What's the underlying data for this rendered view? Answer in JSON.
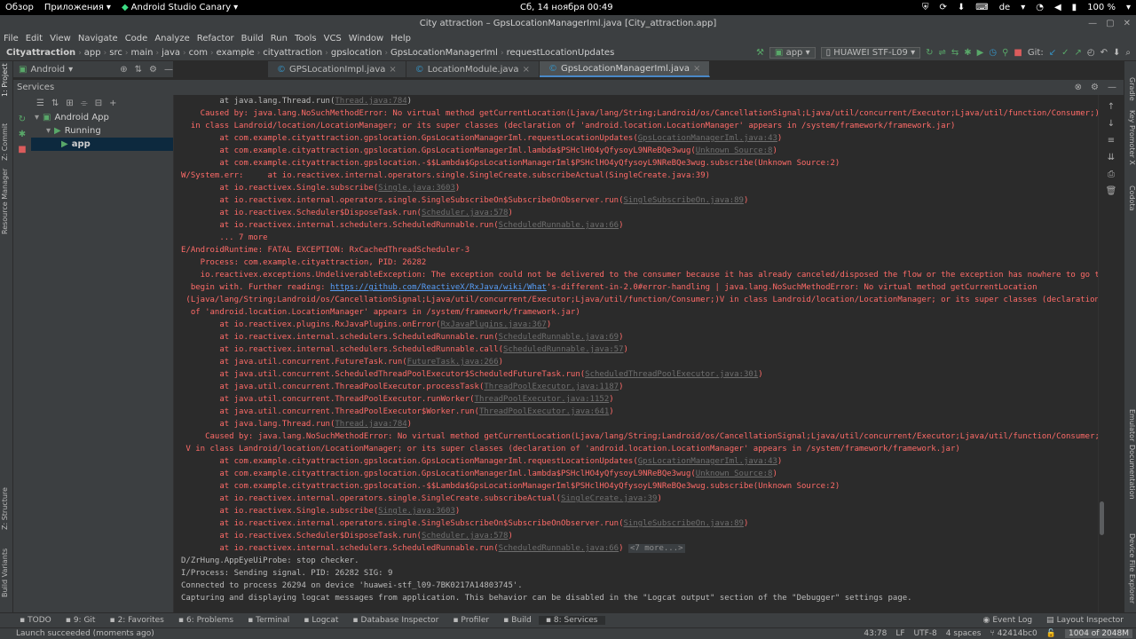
{
  "gnome_bar": {
    "overview": "Обзор",
    "apps": "Приложения",
    "app_name": "Android Studio Canary",
    "clock": "Сб, 14 ноября  00:49",
    "lang": "de",
    "battery": "100 %"
  },
  "window": {
    "title": "City attraction – GpsLocationManagerIml.java [City_attraction.app]"
  },
  "menu": [
    "File",
    "Edit",
    "View",
    "Navigate",
    "Code",
    "Analyze",
    "Refactor",
    "Build",
    "Run",
    "Tools",
    "VCS",
    "Window",
    "Help"
  ],
  "breadcrumbs": [
    "Cityattraction",
    "app",
    "src",
    "main",
    "java",
    "com",
    "example",
    "cityattraction",
    "gpslocation",
    "GpsLocationManagerIml",
    "requestLocationUpdates"
  ],
  "toolbar": {
    "run_config": "app",
    "device": "HUAWEI STF-L09",
    "git_label": "Git:"
  },
  "project_view": {
    "mode": "Android"
  },
  "editor_tabs": [
    {
      "label": "GPSLocationImpl.java",
      "active": false
    },
    {
      "label": "LocationModule.java",
      "active": false
    },
    {
      "label": "GpsLocationManagerIml.java",
      "active": true
    }
  ],
  "services": {
    "title": "Services",
    "tree": [
      {
        "label": "Android App",
        "level": 0
      },
      {
        "label": "Running",
        "level": 1
      },
      {
        "label": "app",
        "level": 2
      }
    ]
  },
  "left_strip": [
    "1: Project",
    "Z: Commit",
    "Resource Manager",
    "Z: Structure",
    "Build Variants",
    "2: Favorites"
  ],
  "right_strip": [
    "Gradle",
    "Key Promoter X",
    "Codota",
    "Emulator",
    "Documentation",
    "Device File Explorer"
  ],
  "console_lines": [
    {
      "type": "n",
      "parts": [
        {
          "t": "        at java.lang.Thread.run("
        },
        {
          "t": "Thread.java:784",
          "c": "lnk"
        },
        {
          "t": ")"
        }
      ]
    },
    {
      "type": "e",
      "parts": [
        {
          "t": "    Caused by: java.lang.NoSuchMethodError: No virtual method getCurrentLocation(Ljava/lang/String;Landroid/os/CancellationSignal;Ljava/util/concurrent/Executor;Ljava/util/function/Consumer;)V"
        }
      ]
    },
    {
      "type": "e",
      "parts": [
        {
          "t": "  in class Landroid/location/LocationManager; or its super classes (declaration of 'android.location.LocationManager' appears in /system/framework/framework.jar)"
        }
      ]
    },
    {
      "type": "e",
      "parts": [
        {
          "t": "        at com.example.cityattraction.gpslocation.GpsLocationManagerIml.requestLocationUpdates("
        },
        {
          "t": "GpsLocationManagerIml.java:43",
          "c": "lnk"
        },
        {
          "t": ")"
        }
      ]
    },
    {
      "type": "e",
      "parts": [
        {
          "t": "        at com.example.cityattraction.gpslocation.GpsLocationManagerIml.lambda$PSHclHO4yQfysoyL9NReBQe3wug("
        },
        {
          "t": "Unknown Source:8",
          "c": "lnk"
        },
        {
          "t": ")"
        }
      ]
    },
    {
      "type": "e",
      "parts": [
        {
          "t": "        at com.example.cityattraction.gpslocation.-$$Lambda$GpsLocationManagerIml$PSHclHO4yQfysoyL9NReBQe3wug.subscribe(Unknown Source:2)"
        }
      ]
    },
    {
      "type": "e",
      "parts": [
        {
          "t": "W/System.err:     at io.reactivex.internal.operators.single.SingleCreate.subscribeActual(SingleCreate.java:39)"
        }
      ]
    },
    {
      "type": "e",
      "parts": [
        {
          "t": "        at io.reactivex.Single.subscribe("
        },
        {
          "t": "Single.java:3603",
          "c": "lnk"
        },
        {
          "t": ")"
        }
      ]
    },
    {
      "type": "e",
      "parts": [
        {
          "t": "        at io.reactivex.internal.operators.single.SingleSubscribeOn$SubscribeOnObserver.run("
        },
        {
          "t": "SingleSubscribeOn.java:89",
          "c": "lnk"
        },
        {
          "t": ")"
        }
      ]
    },
    {
      "type": "e",
      "parts": [
        {
          "t": "        at io.reactivex.Scheduler$DisposeTask.run("
        },
        {
          "t": "Scheduler.java:578",
          "c": "lnk"
        },
        {
          "t": ")"
        }
      ]
    },
    {
      "type": "e",
      "parts": [
        {
          "t": "        at io.reactivex.internal.schedulers.ScheduledRunnable.run("
        },
        {
          "t": "ScheduledRunnable.java:66",
          "c": "lnk"
        },
        {
          "t": ")"
        }
      ]
    },
    {
      "type": "e",
      "parts": [
        {
          "t": "        ... 7 more"
        }
      ]
    },
    {
      "type": "e",
      "parts": [
        {
          "t": "E/AndroidRuntime: FATAL EXCEPTION: RxCachedThreadScheduler-3"
        }
      ]
    },
    {
      "type": "e",
      "parts": [
        {
          "t": "    Process: com.example.cityattraction, PID: 26282"
        }
      ]
    },
    {
      "type": "e",
      "parts": [
        {
          "t": "    io.reactivex.exceptions.UndeliverableException: The exception could not be delivered to the consumer because it has already canceled/disposed the flow or the exception has nowhere to go to"
        }
      ]
    },
    {
      "type": "e",
      "parts": [
        {
          "t": "  begin with. Further reading: "
        },
        {
          "t": "https://github.com/ReactiveX/RxJava/wiki/What",
          "c": "url"
        },
        {
          "t": "'s-different-in-2.0#error-handling | java.lang.NoSuchMethodError: No virtual method getCurrentLocation"
        }
      ]
    },
    {
      "type": "e",
      "parts": [
        {
          "t": " (Ljava/lang/String;Landroid/os/CancellationSignal;Ljava/util/concurrent/Executor;Ljava/util/function/Consumer;)V in class Landroid/location/LocationManager; or its super classes (declaration"
        }
      ]
    },
    {
      "type": "e",
      "parts": [
        {
          "t": "  of 'android.location.LocationManager' appears in /system/framework/framework.jar)"
        }
      ]
    },
    {
      "type": "e",
      "parts": [
        {
          "t": "        at io.reactivex.plugins.RxJavaPlugins.onError("
        },
        {
          "t": "RxJavaPlugins.java:367",
          "c": "lnk"
        },
        {
          "t": ")"
        }
      ]
    },
    {
      "type": "e",
      "parts": [
        {
          "t": "        at io.reactivex.internal.schedulers.ScheduledRunnable.run("
        },
        {
          "t": "ScheduledRunnable.java:69",
          "c": "lnk"
        },
        {
          "t": ")"
        }
      ]
    },
    {
      "type": "e",
      "parts": [
        {
          "t": "        at io.reactivex.internal.schedulers.ScheduledRunnable.call("
        },
        {
          "t": "ScheduledRunnable.java:57",
          "c": "lnk"
        },
        {
          "t": ")"
        }
      ]
    },
    {
      "type": "e",
      "parts": [
        {
          "t": "        at java.util.concurrent.FutureTask.run("
        },
        {
          "t": "FutureTask.java:266",
          "c": "lnk"
        },
        {
          "t": ")"
        }
      ]
    },
    {
      "type": "e",
      "parts": [
        {
          "t": "        at java.util.concurrent.ScheduledThreadPoolExecutor$ScheduledFutureTask.run("
        },
        {
          "t": "ScheduledThreadPoolExecutor.java:301",
          "c": "lnk"
        },
        {
          "t": ")"
        }
      ]
    },
    {
      "type": "e",
      "parts": [
        {
          "t": "        at java.util.concurrent.ThreadPoolExecutor.processTask("
        },
        {
          "t": "ThreadPoolExecutor.java:1187",
          "c": "lnk"
        },
        {
          "t": ")"
        }
      ]
    },
    {
      "type": "e",
      "parts": [
        {
          "t": "        at java.util.concurrent.ThreadPoolExecutor.runWorker("
        },
        {
          "t": "ThreadPoolExecutor.java:1152",
          "c": "lnk"
        },
        {
          "t": ")"
        }
      ]
    },
    {
      "type": "e",
      "parts": [
        {
          "t": "        at java.util.concurrent.ThreadPoolExecutor$Worker.run("
        },
        {
          "t": "ThreadPoolExecutor.java:641",
          "c": "lnk"
        },
        {
          "t": ")"
        }
      ]
    },
    {
      "type": "e",
      "parts": [
        {
          "t": "        at java.lang.Thread.run("
        },
        {
          "t": "Thread.java:784",
          "c": "lnk"
        },
        {
          "t": ")"
        }
      ]
    },
    {
      "type": "e",
      "parts": [
        {
          "t": "     Caused by: java.lang.NoSuchMethodError: No virtual method getCurrentLocation(Ljava/lang/String;Landroid/os/CancellationSignal;Ljava/util/concurrent/Executor;Ljava/util/function/Consumer;)"
        }
      ]
    },
    {
      "type": "e",
      "parts": [
        {
          "t": " V in class Landroid/location/LocationManager; or its super classes (declaration of 'android.location.LocationManager' appears in /system/framework/framework.jar)"
        }
      ]
    },
    {
      "type": "e",
      "parts": [
        {
          "t": "        at com.example.cityattraction.gpslocation.GpsLocationManagerIml.requestLocationUpdates("
        },
        {
          "t": "GpsLocationManagerIml.java:43",
          "c": "lnk"
        },
        {
          "t": ")"
        }
      ]
    },
    {
      "type": "e",
      "parts": [
        {
          "t": "        at com.example.cityattraction.gpslocation.GpsLocationManagerIml.lambda$PSHclHO4yQfysoyL9NReBQe3wug("
        },
        {
          "t": "Unknown Source:8",
          "c": "lnk"
        },
        {
          "t": ")"
        }
      ]
    },
    {
      "type": "e",
      "parts": [
        {
          "t": "        at com.example.cityattraction.gpslocation.-$$Lambda$GpsLocationManagerIml$PSHclHO4yQfysoyL9NReBQe3wug.subscribe(Unknown Source:2)"
        }
      ]
    },
    {
      "type": "e",
      "parts": [
        {
          "t": "        at io.reactivex.internal.operators.single.SingleCreate.subscribeActual("
        },
        {
          "t": "SingleCreate.java:39",
          "c": "lnk"
        },
        {
          "t": ")"
        }
      ]
    },
    {
      "type": "e",
      "parts": [
        {
          "t": "        at io.reactivex.Single.subscribe("
        },
        {
          "t": "Single.java:3603",
          "c": "lnk"
        },
        {
          "t": ")"
        }
      ]
    },
    {
      "type": "e",
      "parts": [
        {
          "t": "        at io.reactivex.internal.operators.single.SingleSubscribeOn$SubscribeOnObserver.run("
        },
        {
          "t": "SingleSubscribeOn.java:89",
          "c": "lnk"
        },
        {
          "t": ")"
        }
      ]
    },
    {
      "type": "e",
      "parts": [
        {
          "t": "        at io.reactivex.Scheduler$DisposeTask.run("
        },
        {
          "t": "Scheduler.java:578",
          "c": "lnk"
        },
        {
          "t": ")"
        }
      ]
    },
    {
      "type": "e",
      "parts": [
        {
          "t": "        at io.reactivex.internal.schedulers.ScheduledRunnable.run("
        },
        {
          "t": "ScheduledRunnable.java:66",
          "c": "lnk"
        },
        {
          "t": ") "
        },
        {
          "t": "<7 more...>",
          "c": "more"
        }
      ]
    },
    {
      "type": "n",
      "parts": [
        {
          "t": "D/ZrHung.AppEyeUiProbe: stop checker."
        }
      ]
    },
    {
      "type": "n",
      "parts": [
        {
          "t": "I/Process: Sending signal. PID: 26282 SIG: 9"
        }
      ]
    },
    {
      "type": "n",
      "parts": [
        {
          "t": "Connected to process 26294 on device 'huawei-stf_l09-7BK0217A14803745'."
        }
      ]
    },
    {
      "type": "n",
      "parts": [
        {
          "t": "Capturing and displaying logcat messages from application. This behavior can be disabled in the \"Logcat output\" section of the \"Debugger\" settings page."
        }
      ]
    }
  ],
  "bottom_tools": [
    {
      "label": "TODO",
      "active": false
    },
    {
      "label": "9: Git",
      "active": false
    },
    {
      "label": "2: Favorites",
      "active": false
    },
    {
      "label": "6: Problems",
      "active": false
    },
    {
      "label": "Terminal",
      "active": false
    },
    {
      "label": "Logcat",
      "active": false
    },
    {
      "label": "Database Inspector",
      "active": false
    },
    {
      "label": "Profiler",
      "active": false
    },
    {
      "label": "Build",
      "active": false
    },
    {
      "label": "8: Services",
      "active": true
    }
  ],
  "bottom_right_tools": [
    "Event Log",
    "Layout Inspector"
  ],
  "status_bar": {
    "message": "Launch succeeded (moments ago)",
    "position": "43:78",
    "line_sep": "LF",
    "encoding": "UTF-8",
    "indent": "4 spaces",
    "vcs": "42414bc0",
    "memory": "1004 of 2048M"
  },
  "colors": {
    "accent": "#4a88c7",
    "error": "#ff6b68",
    "run_green": "#59a869",
    "stop_red": "#db5c5c"
  }
}
